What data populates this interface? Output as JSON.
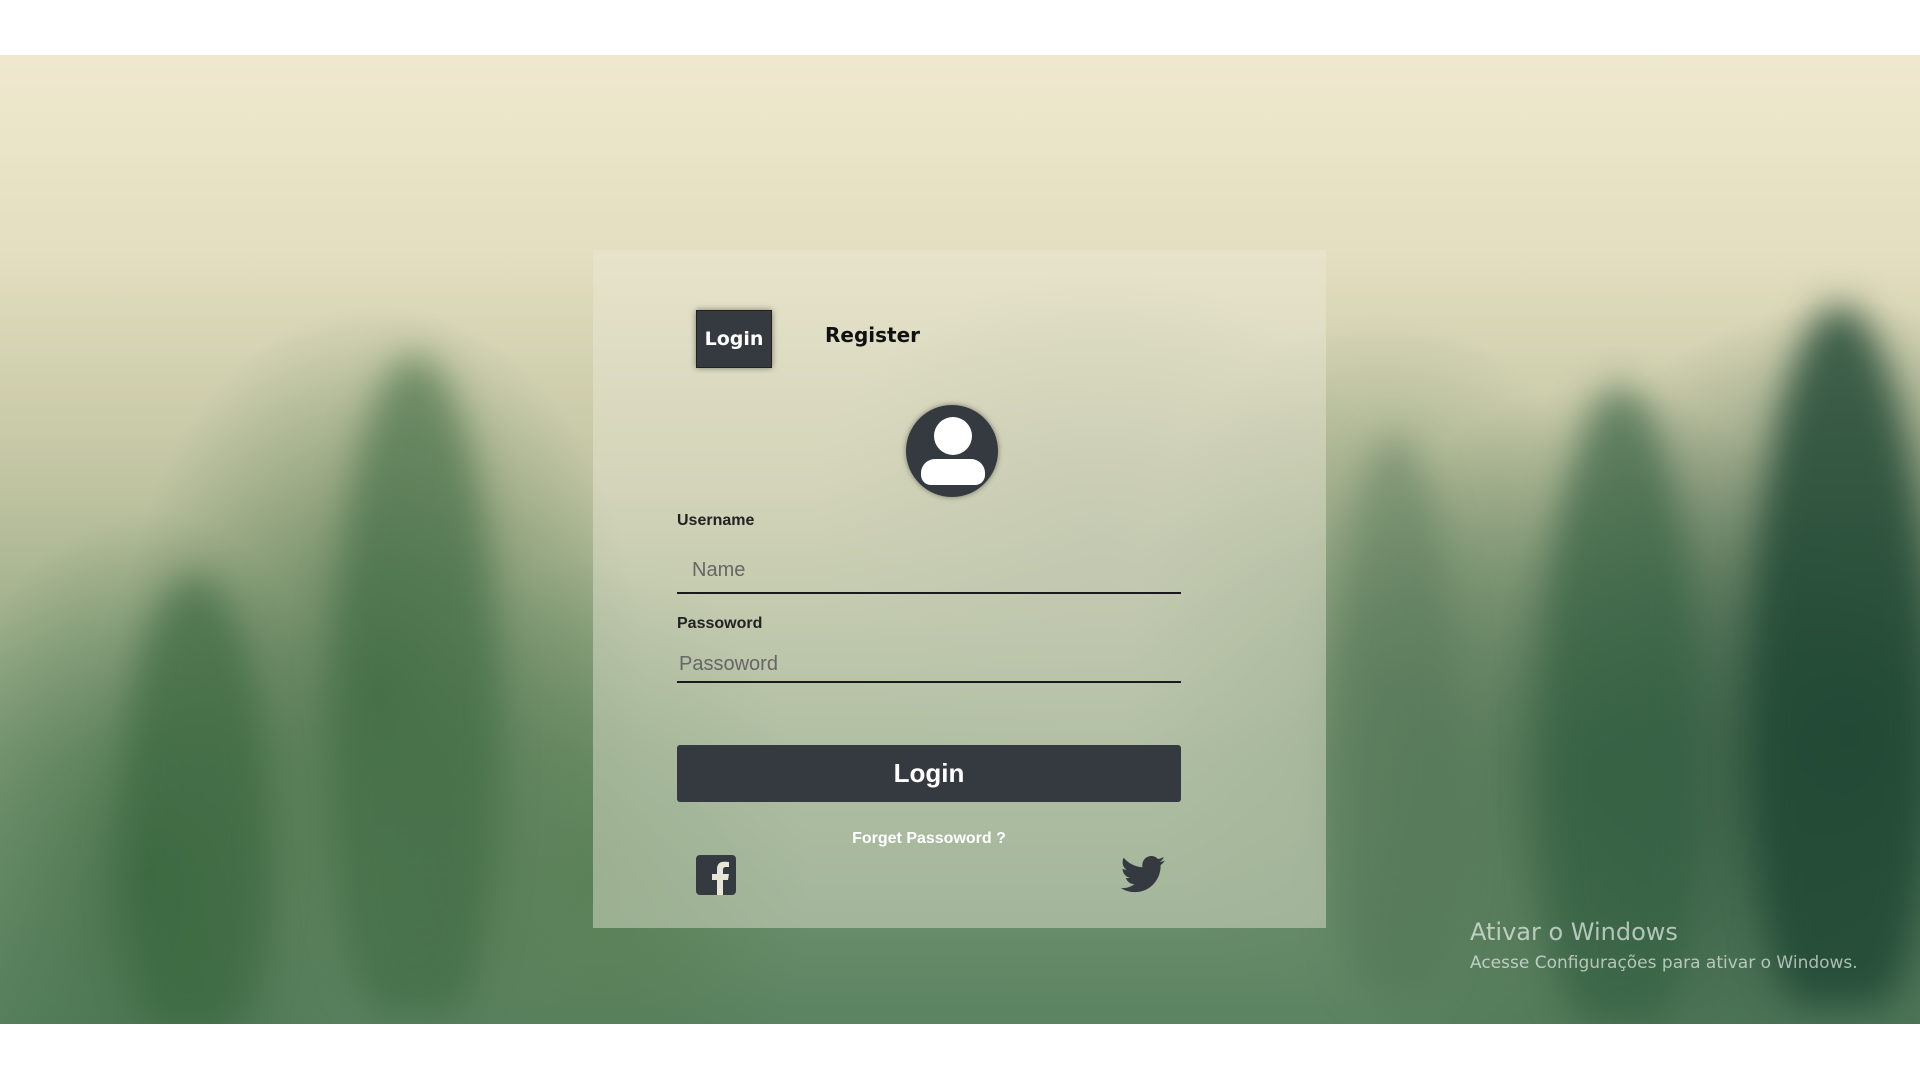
{
  "tabs": {
    "login_label": "Login",
    "register_label": "Register"
  },
  "form": {
    "username_label": "Username",
    "username_placeholder": "Name",
    "password_label": "Passoword",
    "password_placeholder": "Passoword",
    "submit_label": "Login",
    "forgot_label": "Forget Passoword ?"
  },
  "social": {
    "facebook_icon": "facebook-icon",
    "twitter_icon": "twitter-icon"
  },
  "watermark": {
    "title": "Ativar o Windows",
    "subtitle": "Acesse Configurações para ativar o Windows."
  },
  "colors": {
    "primary_dark": "#343a40",
    "card_overlay": "rgba(235,232,215,0.45)"
  }
}
